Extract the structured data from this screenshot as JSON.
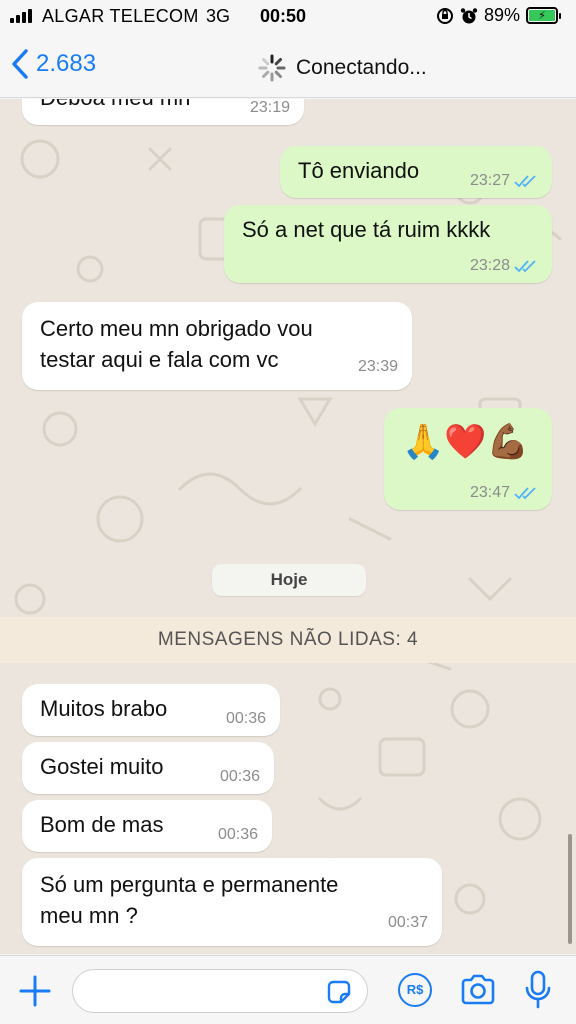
{
  "status_bar": {
    "carrier": "ALGAR TELECOM",
    "network": "3G",
    "time": "00:50",
    "battery": "89%"
  },
  "header": {
    "back_count": "2.683",
    "status": "Conectando..."
  },
  "messages": [
    {
      "direction": "in",
      "text": "Deboa meu mn",
      "time": "23:19"
    },
    {
      "direction": "out",
      "text": "Tô enviando",
      "time": "23:27"
    },
    {
      "direction": "out",
      "text": "Só a net que tá ruim kkkk",
      "time": "23:28"
    },
    {
      "direction": "in",
      "line1": "Certo meu mn obrigado vou",
      "line2": "testar aqui e fala com vc",
      "time": "23:39"
    },
    {
      "direction": "out",
      "text": "🙏❤️💪🏾",
      "time": "23:47"
    },
    {
      "direction": "in",
      "text": "Muitos brabo",
      "time": "00:36"
    },
    {
      "direction": "in",
      "text": "Gostei muito",
      "time": "00:36"
    },
    {
      "direction": "in",
      "text": "Bom de mas",
      "time": "00:36"
    },
    {
      "direction": "in",
      "line1": "Só um pergunta e permanente",
      "line2": "meu mn ?",
      "time": "00:37"
    }
  ],
  "date_separator": "Hoje",
  "unread_banner": "MENSAGENS NÃO LIDAS: 4",
  "input": {
    "placeholder": "",
    "pay_label": "R$"
  },
  "colors": {
    "accent": "#1a7cf5",
    "outgoing_bubble": "#dcf8c6",
    "incoming_bubble": "#ffffff",
    "read_ticks": "#4fb3f6"
  },
  "icons": [
    "signal-icon",
    "orientation-lock-icon",
    "alarm-icon",
    "battery-icon",
    "back-chevron-icon",
    "spinner-icon",
    "read-ticks-icon",
    "plus-icon",
    "sticker-icon",
    "payment-icon",
    "camera-icon",
    "microphone-icon"
  ]
}
